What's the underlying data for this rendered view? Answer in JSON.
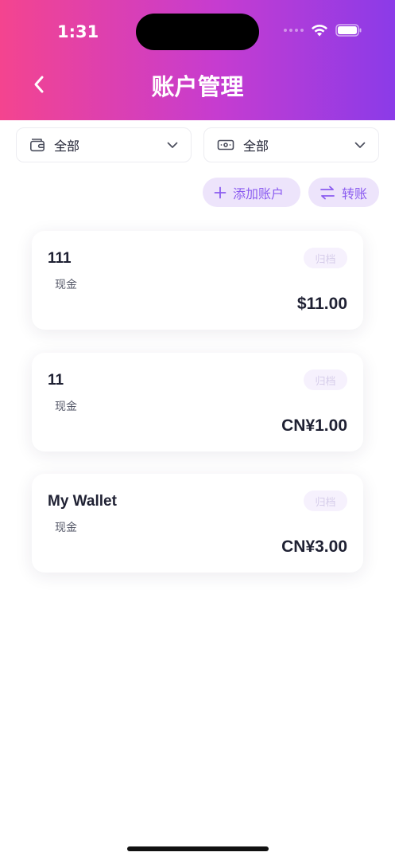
{
  "status_bar": {
    "time": "1:31"
  },
  "header": {
    "title": "账户管理"
  },
  "filters": {
    "wallet_filter": {
      "label": "全部",
      "icon": "wallet-icon"
    },
    "currency_filter": {
      "label": "全部",
      "icon": "banknote-icon"
    }
  },
  "actions": {
    "add_account": {
      "label": "添加账户",
      "icon": "plus-icon"
    },
    "transfer": {
      "label": "转账",
      "icon": "swap-arrows-icon"
    }
  },
  "accounts": [
    {
      "name": "111",
      "type": "现金",
      "archive_label": "归档",
      "amount": "$11.00"
    },
    {
      "name": "11",
      "type": "现金",
      "archive_label": "归档",
      "amount": "CN¥1.00"
    },
    {
      "name": "My Wallet",
      "type": "现金",
      "archive_label": "归档",
      "amount": "CN¥3.00"
    }
  ],
  "colors": {
    "header_gradient_start": "#f4448f",
    "header_gradient_end": "#8b3be8",
    "accent": "#8b5cf0",
    "pill_background": "#ede4fb"
  }
}
